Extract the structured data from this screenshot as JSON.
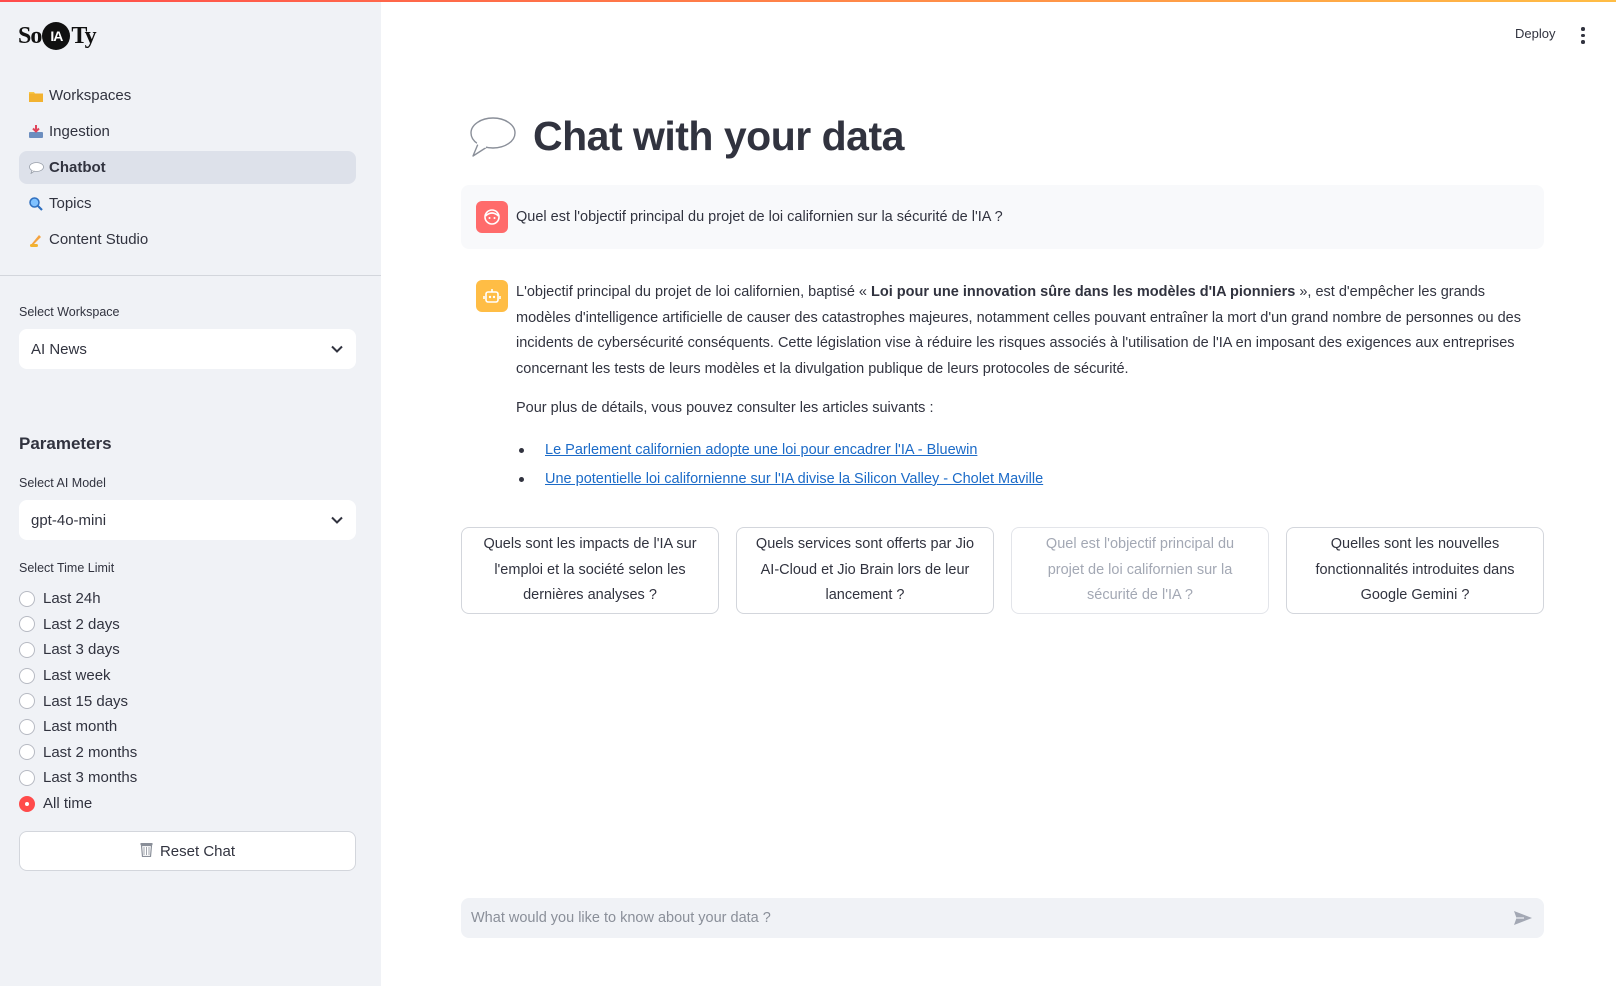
{
  "app": {
    "logo": {
      "pre": "So",
      "badge": "IA",
      "post": "Ty"
    },
    "deploy_label": "Deploy",
    "accent": "#ff4b4b"
  },
  "sidebar": {
    "nav": [
      {
        "label": "Workspaces",
        "icon": "folder-icon",
        "active": false
      },
      {
        "label": "Ingestion",
        "icon": "inbox-tray-icon",
        "active": false
      },
      {
        "label": "Chatbot",
        "icon": "speech-bubble-icon",
        "active": true
      },
      {
        "label": "Topics",
        "icon": "magnifier-icon",
        "active": false
      },
      {
        "label": "Content Studio",
        "icon": "writing-hand-icon",
        "active": false
      }
    ],
    "workspace": {
      "label": "Select Workspace",
      "value": "AI News"
    },
    "parameters_title": "Parameters",
    "model": {
      "label": "Select AI Model",
      "value": "gpt-4o-mini"
    },
    "time_limit": {
      "label": "Select Time Limit",
      "options": [
        "Last 24h",
        "Last 2 days",
        "Last 3 days",
        "Last week",
        "Last 15 days",
        "Last month",
        "Last 2 months",
        "Last 3 months",
        "All time"
      ],
      "selected": "All time"
    },
    "reset_label": "Reset Chat"
  },
  "main": {
    "title": "Chat with your data",
    "user_message": "Quel est l'objectif principal du projet de loi californien sur la sécurité de l'IA ?",
    "bot_message": {
      "intro": "L'objectif principal du projet de loi californien, baptisé « ",
      "bold": "Loi pour une innovation sûre dans les modèles d'IA pionniers",
      "rest": " », est d'empêcher les grands modèles d'intelligence artificielle de causer des catastrophes majeures, notamment celles pouvant entraîner la mort d'un grand nombre de personnes ou des incidents de cybersécurité conséquents. Cette législation vise à réduire les risques associés à l'utilisation de l'IA en imposant des exigences aux entreprises concernant les tests de leurs modèles et la divulgation publique de leurs protocoles de sécurité.",
      "details": "Pour plus de détails, vous pouvez consulter les articles suivants :",
      "links": [
        "Le Parlement californien adopte une loi pour encadrer l'IA - Bluewin",
        "Une potentielle loi californienne sur l'IA divise la Silicon Valley - Cholet Maville"
      ]
    },
    "suggestions": [
      {
        "text": "Quels sont les impacts de l'IA sur l'emploi et la société selon les dernières analyses ?",
        "disabled": false
      },
      {
        "text": "Quels services sont offerts par Jio AI-Cloud et Jio Brain lors de leur lancement ?",
        "disabled": false
      },
      {
        "text": "Quel est l'objectif principal du projet de loi californien sur la sécurité de l'IA ?",
        "disabled": true
      },
      {
        "text": "Quelles sont les nouvelles fonctionnalités introduites dans Google Gemini ?",
        "disabled": false
      }
    ],
    "input_placeholder": "What would you like to know about your data ?"
  }
}
